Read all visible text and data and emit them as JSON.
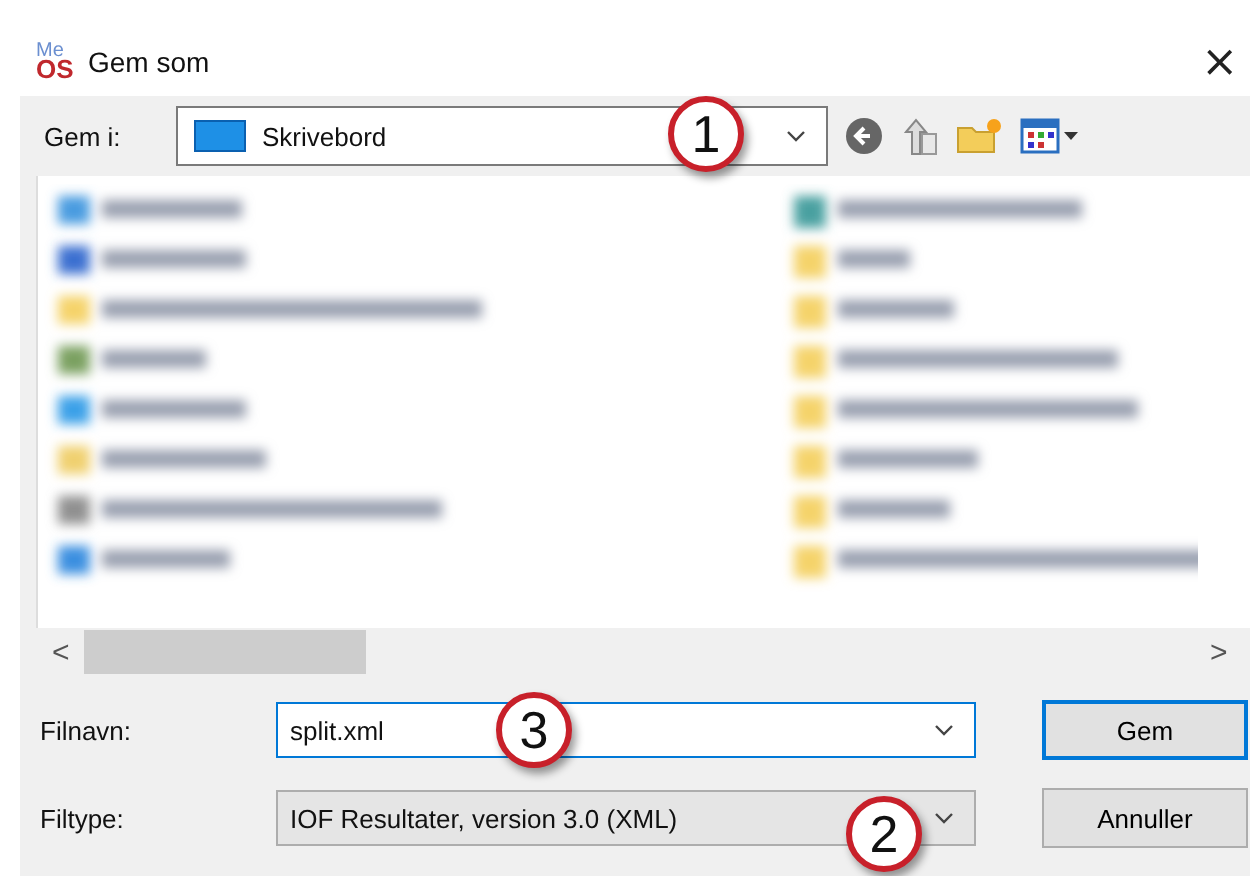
{
  "window": {
    "title": "Gem som",
    "logo": [
      "Me",
      "OS"
    ],
    "close": "×"
  },
  "save_in": {
    "label": "Gem i:",
    "value": "Skrivebord",
    "callout": "1"
  },
  "scrollbar": {
    "left": "<",
    "right": ">"
  },
  "file_name": {
    "label": "Filnavn:",
    "value": "split.xml",
    "callout": "3"
  },
  "file_type": {
    "label": "Filtype:",
    "value": "IOF Resultater, version 3.0 (XML)",
    "callout": "2"
  },
  "buttons": [
    {
      "label": "Gem",
      "default": true
    },
    {
      "label": "Annuller",
      "default": false
    }
  ]
}
